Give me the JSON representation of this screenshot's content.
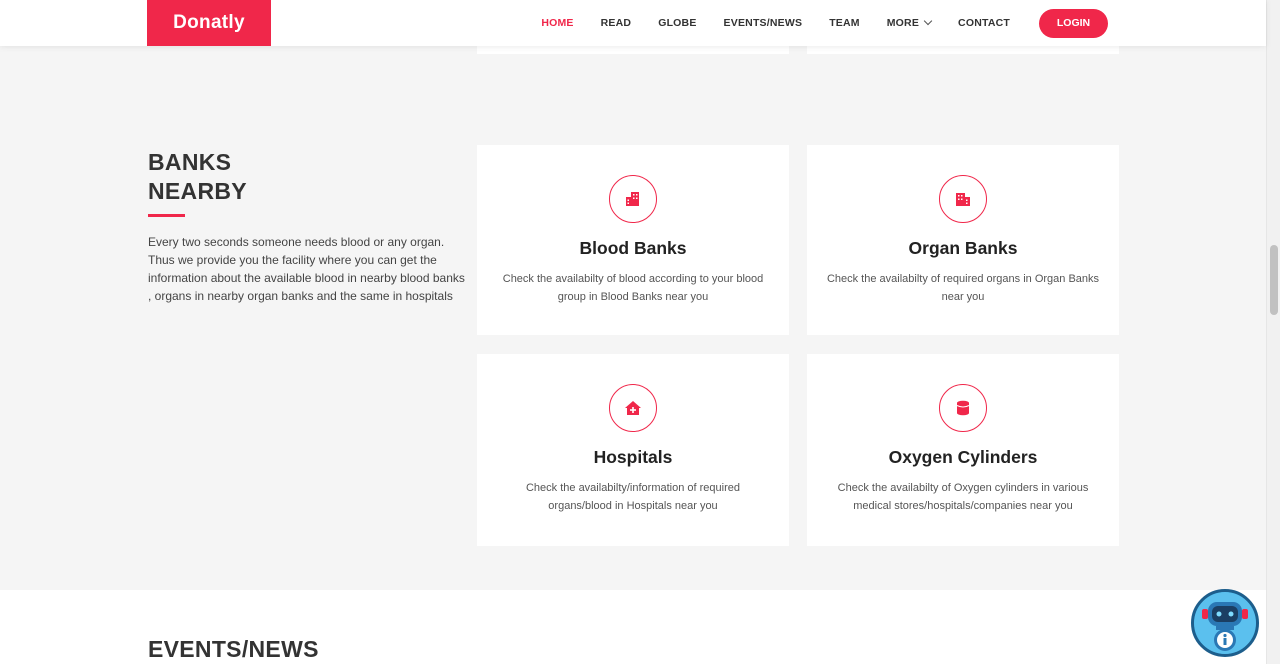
{
  "header": {
    "logo": "Donatly",
    "nav": [
      {
        "label": "HOME",
        "active": true
      },
      {
        "label": "READ",
        "active": false
      },
      {
        "label": "GLOBE",
        "active": false
      },
      {
        "label": "EVENTS/NEWS",
        "active": false
      },
      {
        "label": "TEAM",
        "active": false
      },
      {
        "label": "MORE",
        "active": false
      },
      {
        "label": "CONTACT",
        "active": false
      }
    ],
    "login_label": "LOGIN"
  },
  "banks_section": {
    "title_line1": "BANKS",
    "title_line2": "NEARBY",
    "description": "Every two seconds someone needs blood or any organ. Thus we provide you the facility where you can get the information about the available blood in nearby blood banks , organs in nearby organ banks and the same in hospitals",
    "cards": [
      {
        "icon": "blood-bank-icon",
        "title": "Blood Banks",
        "desc": "Check the availabilty of blood according to your blood group in Blood Banks near you"
      },
      {
        "icon": "organ-bank-icon",
        "title": "Organ Banks",
        "desc": "Check the availabilty of required organs in Organ Banks near you"
      },
      {
        "icon": "hospital-icon",
        "title": "Hospitals",
        "desc": "Check the availabilty/information of required organs/blood in Hospitals near you"
      },
      {
        "icon": "oxygen-cylinder-icon",
        "title": "Oxygen Cylinders",
        "desc": "Check the availabilty of Oxygen cylinders in various medical stores/hospitals/companies near you"
      }
    ]
  },
  "events_section": {
    "title": "EVENTS/NEWS"
  },
  "colors": {
    "accent": "#f0274a",
    "background": "#f5f5f5",
    "card": "#ffffff"
  }
}
